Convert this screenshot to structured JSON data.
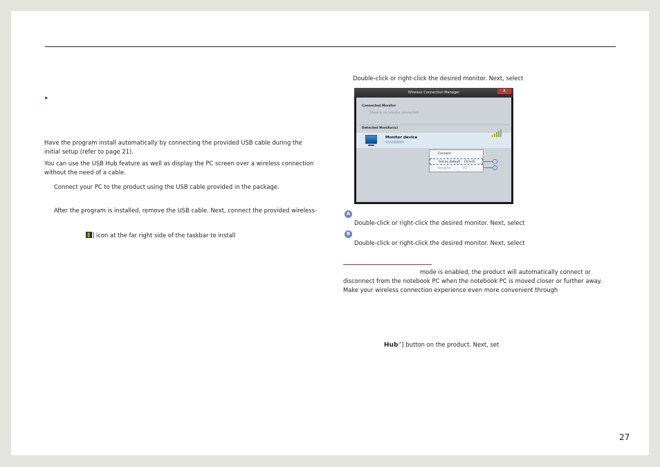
{
  "left": {
    "para1": "Have the program install automatically by connecting the provided USB cable during the initial setup (refer to page 21).",
    "para2": "You can use the USB Hub feature as well as display the PC screen over a wireless connection without the need of a cable.",
    "step1": "Connect your PC to the product using the USB cable provided in the package.",
    "step2": "After the program is installed, remove the USB cable. Next, connect the provided wireless-",
    "step3": "] icon at the far right side of the taskbar to install"
  },
  "right": {
    "intro": "Double-click or right-click the desired monitor. Next, select",
    "label_a": "A",
    "desc_a": "Double-click or right-click the desired monitor. Next, select",
    "label_b": "B",
    "desc_b": "Double-click or right-click the desired monitor. Next, select",
    "note_line1": "mode is enabled, the product will automatically connect or",
    "note_line2": "disconnect from the notebook PC when the notebook PC is moved closer or further away.",
    "note_line3": "Make your wireless connection experience even more convenient through",
    "hub_glyph": "Hub",
    "hub_text": "] button on the product. Next, set"
  },
  "window": {
    "title": "Wireless Connection Manager",
    "close": "X",
    "connected_heading": "Connected Monitor",
    "no_monitor": "There is no monitor connected.",
    "detected_heading": "Detected Monitor(s)",
    "device_name": "Monitor device",
    "device_id": "H1A1000001",
    "menu_connect": "Connect",
    "menu_default": "Set as default",
    "menu_default_shortcut": "Ctrl+D",
    "menu_rename": "Rename",
    "menu_rename_shortcut": "F2",
    "callout_a": "A",
    "callout_b": "B"
  },
  "page_number": "27"
}
